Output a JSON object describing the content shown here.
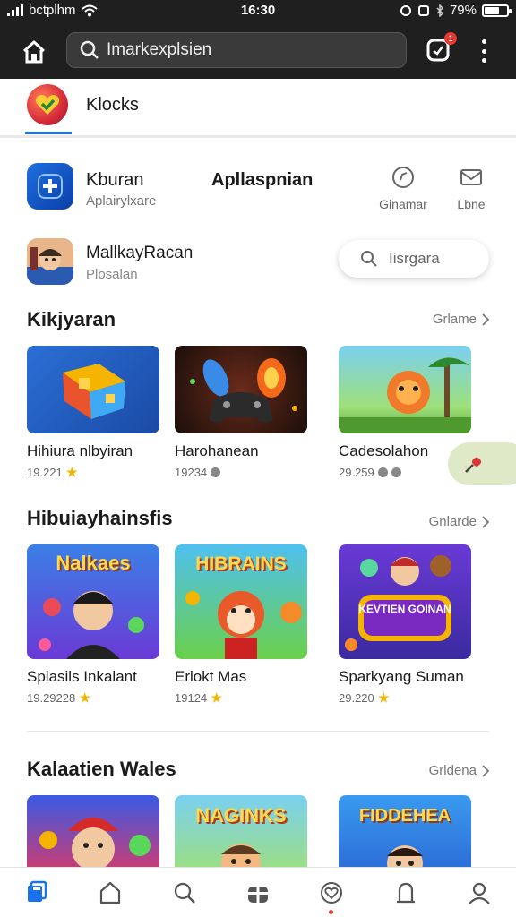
{
  "status": {
    "carrier": "bctplhm",
    "time": "16:30",
    "battery": "79%"
  },
  "topbar": {
    "search_placeholder": "Imarkexplsien",
    "notification_count": "1"
  },
  "tab": {
    "label": "Klocks"
  },
  "app1": {
    "name": "Kburan",
    "subtitle": "Aplairylxare",
    "middle_label": "Apllaspnian",
    "action1": "Ginamar",
    "action2": "Lbne"
  },
  "app2": {
    "name": "MallkayRacan",
    "subtitle": "Plosalan",
    "search_placeholder": "Iisrgara"
  },
  "sections": [
    {
      "title": "Kikjyaran",
      "more": "Grlame",
      "cards": [
        {
          "title": "Hihiura nlbyiran",
          "meta": "19.221"
        },
        {
          "title": "Harohanean",
          "meta": "19234"
        },
        {
          "title": "Cadesolahon",
          "meta": "29.259"
        }
      ]
    },
    {
      "title": "Hibuiayhainsfis",
      "more": "Gnlarde",
      "cards": [
        {
          "title": "Splasils Inkalant",
          "meta": "19.29228",
          "thumb_text": "Nalkaes"
        },
        {
          "title": "Erlokt Mas",
          "meta": "19124",
          "thumb_text": "HIBRAINS"
        },
        {
          "title": "Sparkyang Suman",
          "meta": "29.220",
          "thumb_text": "KEVTIEN GOINAN"
        }
      ]
    },
    {
      "title": "Kalaatien Wales",
      "more": "Grldena",
      "cards": [
        {
          "title": "",
          "meta": ""
        },
        {
          "title": "",
          "meta": "",
          "thumb_text": "NAGINKS"
        },
        {
          "title": "",
          "meta": "",
          "thumb_text": "FIDDEHEA"
        }
      ]
    }
  ],
  "colors": {
    "accent": "#1a73e8",
    "topbar_bg": "#1f1f1f",
    "star": "#f4b400"
  }
}
